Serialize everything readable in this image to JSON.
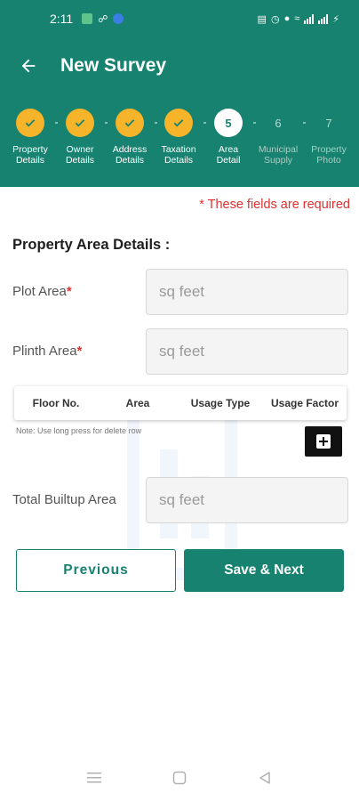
{
  "status_bar": {
    "time": "2:11",
    "battery_icon": "charging-battery-icon"
  },
  "app_bar": {
    "title": "New Survey",
    "back_icon": "arrow-back-icon"
  },
  "stepper": {
    "steps": [
      {
        "number": "1",
        "label_line1": "Property",
        "label_line2": "Details",
        "state": "done"
      },
      {
        "number": "2",
        "label_line1": "Owner",
        "label_line2": "Details",
        "state": "done"
      },
      {
        "number": "3",
        "label_line1": "Address",
        "label_line2": "Details",
        "state": "done"
      },
      {
        "number": "4",
        "label_line1": "Taxation",
        "label_line2": "Details",
        "state": "done"
      },
      {
        "number": "5",
        "label_line1": "Area",
        "label_line2": "Detail",
        "state": "active"
      },
      {
        "number": "6",
        "label_line1": "Municipal",
        "label_line2": "Supply",
        "state": "future"
      },
      {
        "number": "7",
        "label_line1": "Property",
        "label_line2": "Photo",
        "state": "future"
      }
    ]
  },
  "form": {
    "required_note": "* These fields are required",
    "section_title": "Property Area Details :",
    "plot_area": {
      "label": "Plot Area",
      "required_mark": "*",
      "placeholder": "sq feet",
      "value": ""
    },
    "plinth_area": {
      "label": "Plinth Area",
      "required_mark": "*",
      "placeholder": "sq feet",
      "value": ""
    },
    "floor_table": {
      "columns": [
        "Floor No.",
        "Area",
        "Usage Type",
        "Usage Factor"
      ],
      "note": "Note: Use long press for delete row"
    },
    "total_builtup": {
      "label": "Total Builtup Area",
      "placeholder": "sq feet",
      "value": ""
    }
  },
  "buttons": {
    "previous": "Previous",
    "save_next": "Save & Next"
  },
  "colors": {
    "primary": "#16826f",
    "step_done": "#f5b42a",
    "required": "#e0302f"
  }
}
